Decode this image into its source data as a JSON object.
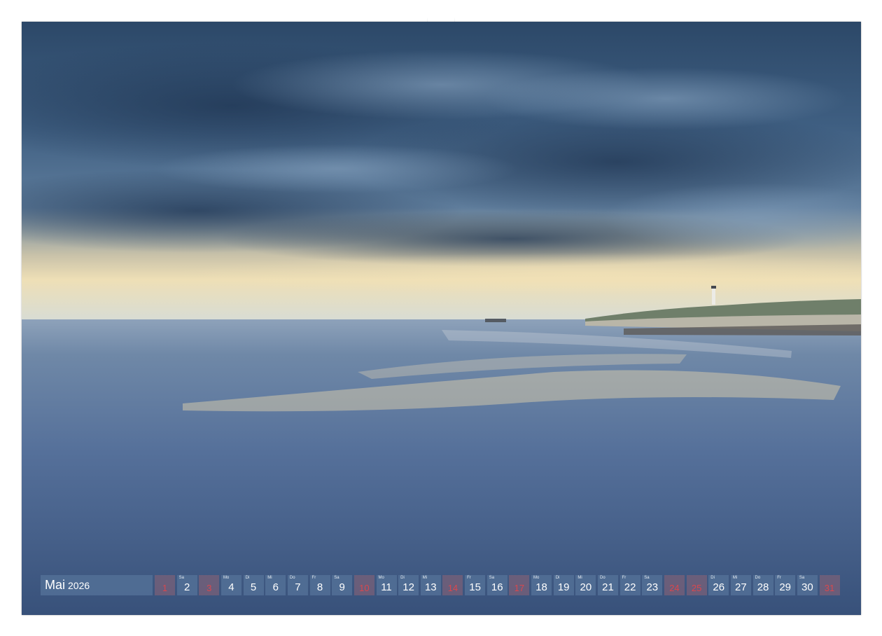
{
  "calendar": {
    "month": "Mai",
    "year": "2026",
    "days": [
      {
        "num": "1",
        "wd": "",
        "weekend": true
      },
      {
        "num": "2",
        "wd": "Sa",
        "weekend": false
      },
      {
        "num": "3",
        "wd": "",
        "weekend": true
      },
      {
        "num": "4",
        "wd": "Mo",
        "weekend": false
      },
      {
        "num": "5",
        "wd": "Di",
        "weekend": false
      },
      {
        "num": "6",
        "wd": "Mi",
        "weekend": false
      },
      {
        "num": "7",
        "wd": "Do",
        "weekend": false
      },
      {
        "num": "8",
        "wd": "Fr",
        "weekend": false
      },
      {
        "num": "9",
        "wd": "Sa",
        "weekend": false
      },
      {
        "num": "10",
        "wd": "",
        "weekend": true
      },
      {
        "num": "11",
        "wd": "Mo",
        "weekend": false
      },
      {
        "num": "12",
        "wd": "Di",
        "weekend": false
      },
      {
        "num": "13",
        "wd": "Mi",
        "weekend": false
      },
      {
        "num": "14",
        "wd": "",
        "weekend": true
      },
      {
        "num": "15",
        "wd": "Fr",
        "weekend": false
      },
      {
        "num": "16",
        "wd": "Sa",
        "weekend": false
      },
      {
        "num": "17",
        "wd": "",
        "weekend": true
      },
      {
        "num": "18",
        "wd": "Mo",
        "weekend": false
      },
      {
        "num": "19",
        "wd": "Di",
        "weekend": false
      },
      {
        "num": "20",
        "wd": "Mi",
        "weekend": false
      },
      {
        "num": "21",
        "wd": "Do",
        "weekend": false
      },
      {
        "num": "22",
        "wd": "Fr",
        "weekend": false
      },
      {
        "num": "23",
        "wd": "Sa",
        "weekend": false
      },
      {
        "num": "24",
        "wd": "",
        "weekend": true
      },
      {
        "num": "25",
        "wd": "",
        "weekend": true
      },
      {
        "num": "26",
        "wd": "Di",
        "weekend": false
      },
      {
        "num": "27",
        "wd": "Mi",
        "weekend": false
      },
      {
        "num": "28",
        "wd": "Do",
        "weekend": false
      },
      {
        "num": "29",
        "wd": "Fr",
        "weekend": false
      },
      {
        "num": "30",
        "wd": "Sa",
        "weekend": false
      },
      {
        "num": "31",
        "wd": "",
        "weekend": true
      }
    ]
  },
  "colors": {
    "sky_dark": "#2e4b6b",
    "sky_mid": "#5f7f9f",
    "horizon_glow": "#f0d9a8",
    "sea": "#4e6a8f",
    "calendar_cell": "#52708f",
    "holiday_text": "#d8484e"
  }
}
